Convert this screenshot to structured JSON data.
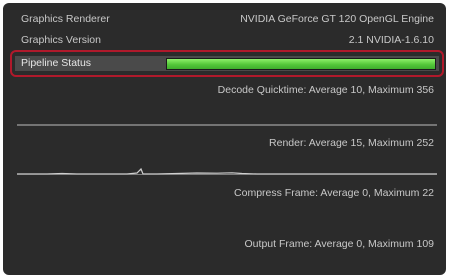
{
  "info": {
    "renderer_label": "Graphics Renderer",
    "renderer_value": "NVIDIA GeForce GT 120 OpenGL Engine",
    "version_label": "Graphics Version",
    "version_value": "2.1 NVIDIA-1.6.10"
  },
  "pipeline": {
    "label": "Pipeline Status",
    "progress": 1.0,
    "highlight_color": "#b0192b",
    "bar_color": "#5fd142"
  },
  "stats": {
    "decode": "Decode Quicktime: Average 10, Maximum 356",
    "render": "Render: Average 15, Maximum 252",
    "compress": "Compress Frame: Average 0, Maximum 22",
    "output": "Output Frame: Average 0, Maximum 109"
  }
}
